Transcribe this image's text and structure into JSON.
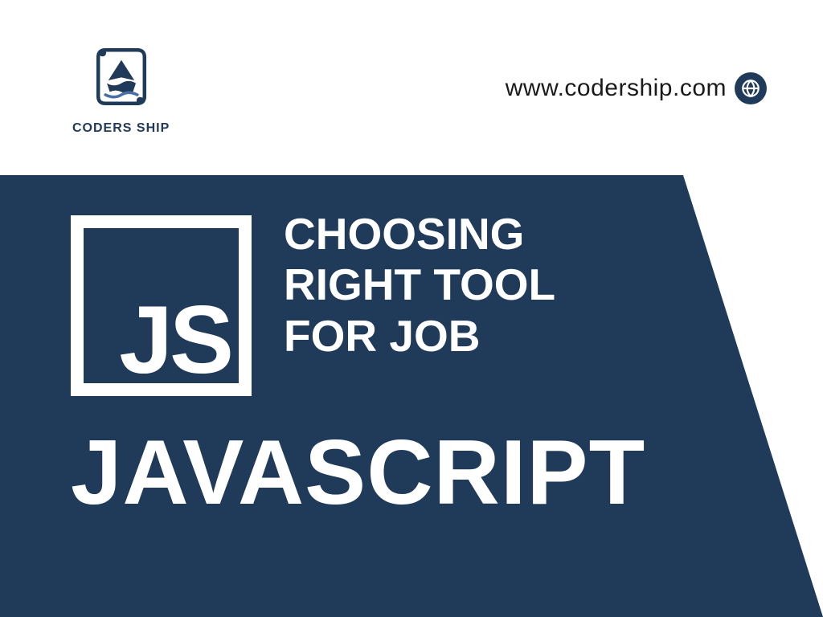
{
  "brand": {
    "name": "CODERS SHIP"
  },
  "url": "www.codership.com",
  "js_label": "JS",
  "headline": {
    "line1": "CHOOSING",
    "line2": "RIGHT TOOL",
    "line3": "FOR JOB"
  },
  "title": "JAVASCRIPT",
  "colors": {
    "navy": "#203a5a",
    "white": "#ffffff"
  }
}
